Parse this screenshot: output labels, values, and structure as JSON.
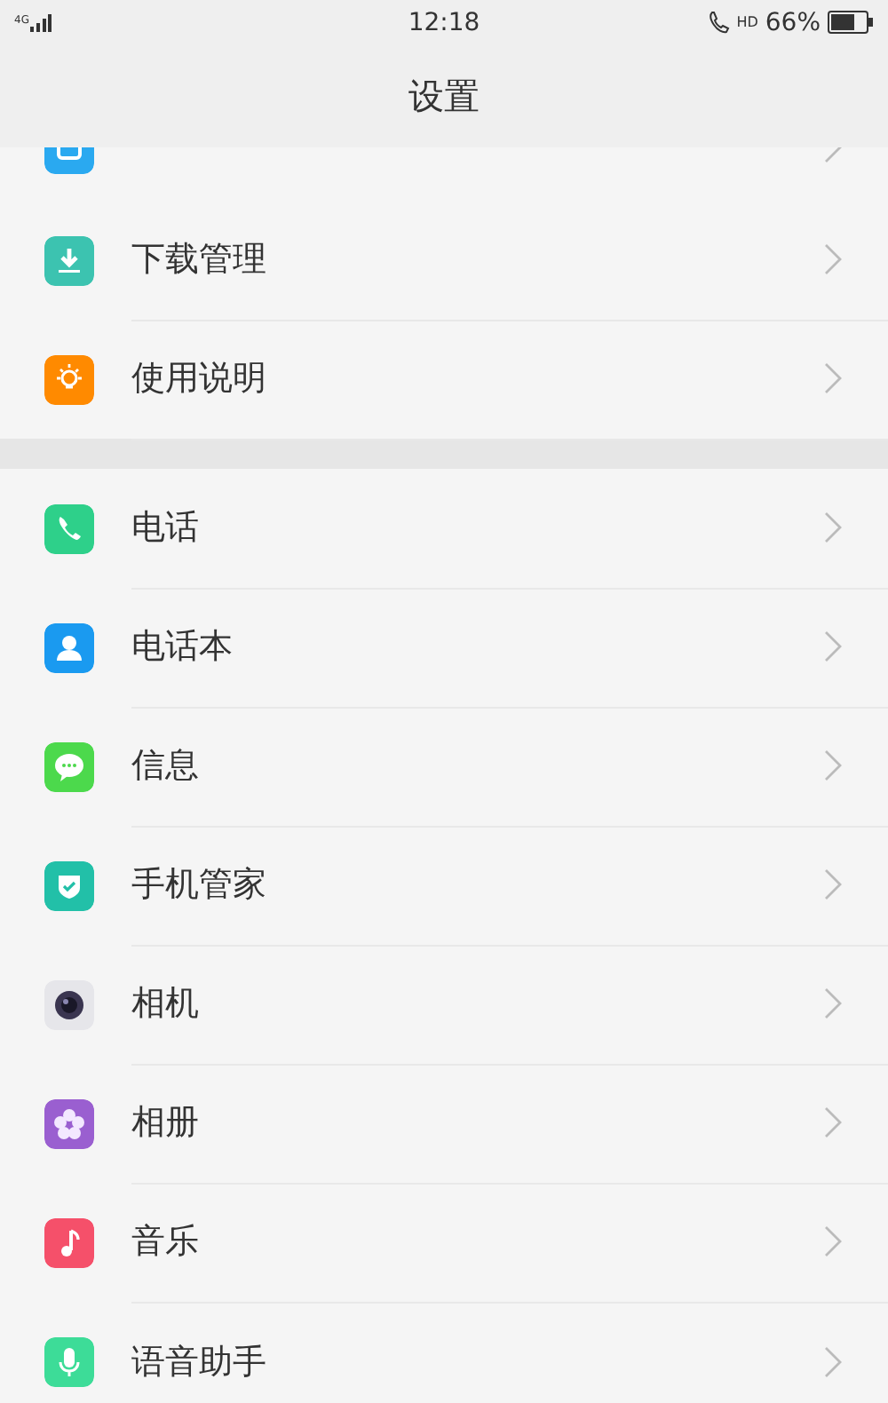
{
  "status_bar": {
    "network": "4G",
    "time": "12:18",
    "call_badge": "HD",
    "battery": "66%"
  },
  "title": "设置",
  "sections": [
    {
      "items": [
        {
          "label": "下载管理"
        },
        {
          "label": "使用说明"
        }
      ]
    },
    {
      "items": [
        {
          "label": "电话"
        },
        {
          "label": "电话本"
        },
        {
          "label": "信息"
        },
        {
          "label": "手机管家"
        },
        {
          "label": "相机"
        },
        {
          "label": "相册"
        },
        {
          "label": "音乐"
        },
        {
          "label": "语音助手"
        }
      ]
    }
  ]
}
